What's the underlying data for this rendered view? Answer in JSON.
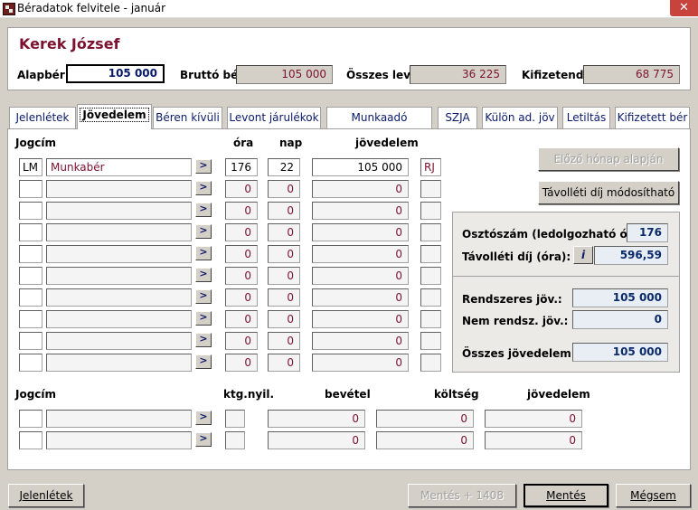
{
  "window": {
    "title": "Béradatok felvitele - január",
    "close_glyph": "✕"
  },
  "header": {
    "employee_name": "Kerek  József",
    "base_salary_label": "Alapbér:",
    "base_salary_value": "105 000",
    "gross_label": "Bruttó bér:",
    "gross_value": "105 000",
    "deductions_label": "Összes lev.:",
    "deductions_value": "36 225",
    "net_label": "Kifizetendő:",
    "net_value": "68 775"
  },
  "tabs": [
    {
      "label": "Jelenlétek"
    },
    {
      "label": "Jövedelem"
    },
    {
      "label": "Béren kívüli"
    },
    {
      "label": "Levont járulékok"
    },
    {
      "label": "Munkaadó járulékai"
    },
    {
      "label": "SZJA"
    },
    {
      "label": "Külön ad. jöv"
    },
    {
      "label": "Letiltás"
    },
    {
      "label": "Kifizetett bér"
    }
  ],
  "income_table": {
    "headers": {
      "jogcim": "Jogcím",
      "ora": "óra",
      "nap": "nap",
      "jovedelem": "jövedelem"
    },
    "arrow_label": ">",
    "rows": [
      {
        "code": "LM",
        "name": "Munkabér",
        "ora": "176",
        "nap": "22",
        "jovedelem": "105 000",
        "flag": "RJ"
      },
      {
        "code": "",
        "name": "",
        "ora": "0",
        "nap": "0",
        "jovedelem": "0",
        "flag": ""
      },
      {
        "code": "",
        "name": "",
        "ora": "0",
        "nap": "0",
        "jovedelem": "0",
        "flag": ""
      },
      {
        "code": "",
        "name": "",
        "ora": "0",
        "nap": "0",
        "jovedelem": "0",
        "flag": ""
      },
      {
        "code": "",
        "name": "",
        "ora": "0",
        "nap": "0",
        "jovedelem": "0",
        "flag": ""
      },
      {
        "code": "",
        "name": "",
        "ora": "0",
        "nap": "0",
        "jovedelem": "0",
        "flag": ""
      },
      {
        "code": "",
        "name": "",
        "ora": "0",
        "nap": "0",
        "jovedelem": "0",
        "flag": ""
      },
      {
        "code": "",
        "name": "",
        "ora": "0",
        "nap": "0",
        "jovedelem": "0",
        "flag": ""
      },
      {
        "code": "",
        "name": "",
        "ora": "0",
        "nap": "0",
        "jovedelem": "0",
        "flag": ""
      },
      {
        "code": "",
        "name": "",
        "ora": "0",
        "nap": "0",
        "jovedelem": "0",
        "flag": ""
      }
    ]
  },
  "side_buttons": {
    "previous_month": "Előző hónap alapján",
    "absence_fee_editable": "Távolléti díj módosítható"
  },
  "info": {
    "divisor_label": "Osztószám (ledolgozható óra):",
    "divisor_value": "176",
    "absence_fee_label": "Távolléti díj (óra):",
    "info_button": "i",
    "absence_fee_value": "596,59",
    "regular_income_label": "Rendszeres jöv.:",
    "regular_income_value": "105 000",
    "irregular_income_label": "Nem rendsz. jöv.:",
    "irregular_income_value": "0",
    "total_income_label": "Összes jövedelem:",
    "total_income_value": "105 000"
  },
  "cost_table": {
    "headers": {
      "jogcim": "Jogcím",
      "ktg": "ktg.nyil.",
      "bevetel": "bevétel",
      "koltseg": "költség",
      "jovedelem": "jövedelem"
    },
    "rows": [
      {
        "code": "",
        "name": "",
        "ktg": "",
        "bevetel": "0",
        "koltseg": "0",
        "jovedelem": "0"
      },
      {
        "code": "",
        "name": "",
        "ktg": "",
        "bevetel": "0",
        "koltseg": "0",
        "jovedelem": "0"
      }
    ]
  },
  "footer": {
    "attendance_button": "Jelenlétek",
    "save_1408_button": "Mentés + 1408",
    "save_button": "Mentés",
    "cancel_button": "Mégsem"
  }
}
